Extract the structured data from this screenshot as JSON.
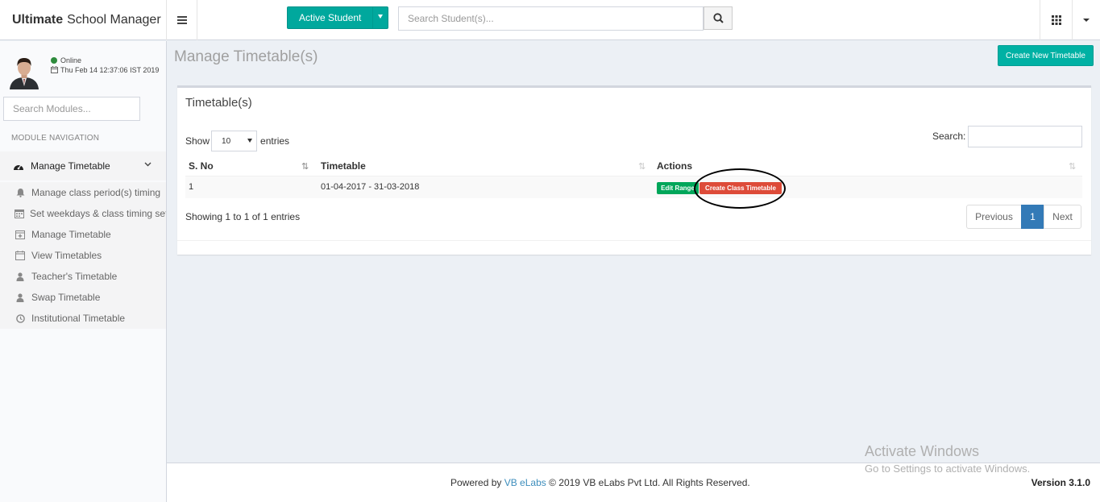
{
  "header": {
    "brand_bold": "Ultimate",
    "brand_rest": "School Manager",
    "active_student_label": "Active Student",
    "student_search_placeholder": "Search Student(s)..."
  },
  "sidebar": {
    "status": "Online",
    "datetime": "Thu Feb 14 12:37:06 IST 2019",
    "module_search_placeholder": "Search Modules...",
    "nav_header": "MODULE NAVIGATION",
    "parent_label": "Manage Timetable",
    "items": [
      {
        "label": "Manage class period(s) timing",
        "icon": "bell-icon"
      },
      {
        "label": "Set weekdays & class timing sets",
        "icon": "calendar-icon"
      },
      {
        "label": "Manage Timetable",
        "icon": "calendar-plus-icon"
      },
      {
        "label": "View Timetables",
        "icon": "calendar-icon"
      },
      {
        "label": "Teacher's Timetable",
        "icon": "user-icon"
      },
      {
        "label": "Swap Timetable",
        "icon": "user-icon"
      },
      {
        "label": "Institutional Timetable",
        "icon": "clock-icon"
      }
    ]
  },
  "main": {
    "page_title": "Manage Timetable(s)",
    "create_new_label": "Create New Timetable",
    "box_title": "Timetable(s)",
    "show_label": "Show",
    "entries_label": "entries",
    "length_value": "10",
    "search_label": "Search:",
    "columns": [
      "S. No",
      "Timetable",
      "Actions"
    ],
    "rows": [
      {
        "sno": "1",
        "timetable": "01-04-2017 - 31-03-2018",
        "edit_label": "Edit Range",
        "create_label": "Create Class Timetable"
      }
    ],
    "info": "Showing 1 to 1 of 1 entries",
    "pagination": {
      "previous": "Previous",
      "current": "1",
      "next": "Next"
    }
  },
  "footer": {
    "powered_by": "Powered by",
    "company_link": "VB eLabs",
    "rights": "© 2019 VB eLabs Pvt Ltd. All Rights Reserved.",
    "version": "Version 3.1.0"
  },
  "watermark": {
    "line1": "Activate Windows",
    "line2": "Go to Settings to activate Windows."
  },
  "colors": {
    "teal": "#00a89d",
    "edit_green": "#00a65a",
    "create_red": "#dd4b39",
    "pager_blue": "#337ab7",
    "link_blue": "#3c8dbc"
  }
}
